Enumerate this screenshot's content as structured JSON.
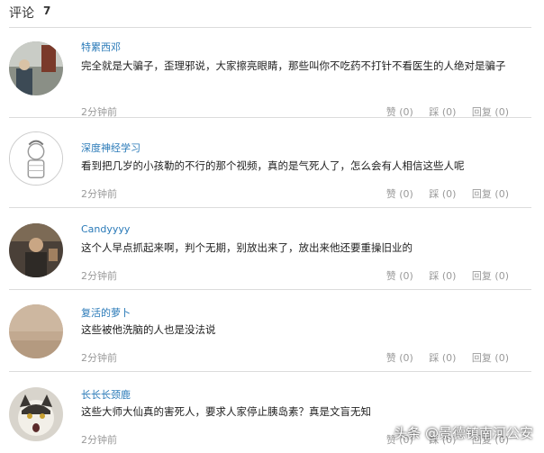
{
  "header": {
    "label": "评论",
    "count": "7"
  },
  "comments": [
    {
      "user": "特累西邓",
      "text": "完全就是大骗子，歪理邪说，大家擦亮眼睛，那些叫你不吃药不打针不看医生的人绝对是骗子",
      "time": "2分钟前",
      "like": "赞 (0)",
      "dislike": "踩 (0)",
      "reply": "回复 (0)"
    },
    {
      "user": "深度神经学习",
      "text": "看到把几岁的小孩勒的不行的那个视频，真的是气死人了，怎么会有人相信这些人呢",
      "time": "2分钟前",
      "like": "赞 (0)",
      "dislike": "踩 (0)",
      "reply": "回复 (0)"
    },
    {
      "user": "Candyyyy",
      "text": "这个人早点抓起来啊，判个无期，别放出来了，放出来他还要重操旧业的",
      "time": "2分钟前",
      "like": "赞 (0)",
      "dislike": "踩 (0)",
      "reply": "回复 (0)"
    },
    {
      "user": "复活的萝卜",
      "text": "这些被他洗脑的人也是没法说",
      "time": "2分钟前",
      "like": "赞 (0)",
      "dislike": "踩 (0)",
      "reply": "回复 (0)"
    },
    {
      "user": "长长长颈鹿",
      "text": "这些大师大仙真的害死人，要求人家停止胰岛素？真是文盲无知",
      "time": "2分钟前",
      "like": "赞 (0)",
      "dislike": "踩 (0)",
      "reply": "回复 (0)"
    }
  ],
  "watermark": "头条 @景德镇南河公安",
  "colors": {
    "username": "#2a7ab8",
    "meta": "#9a9a9a",
    "divider": "#dcdcdc"
  }
}
